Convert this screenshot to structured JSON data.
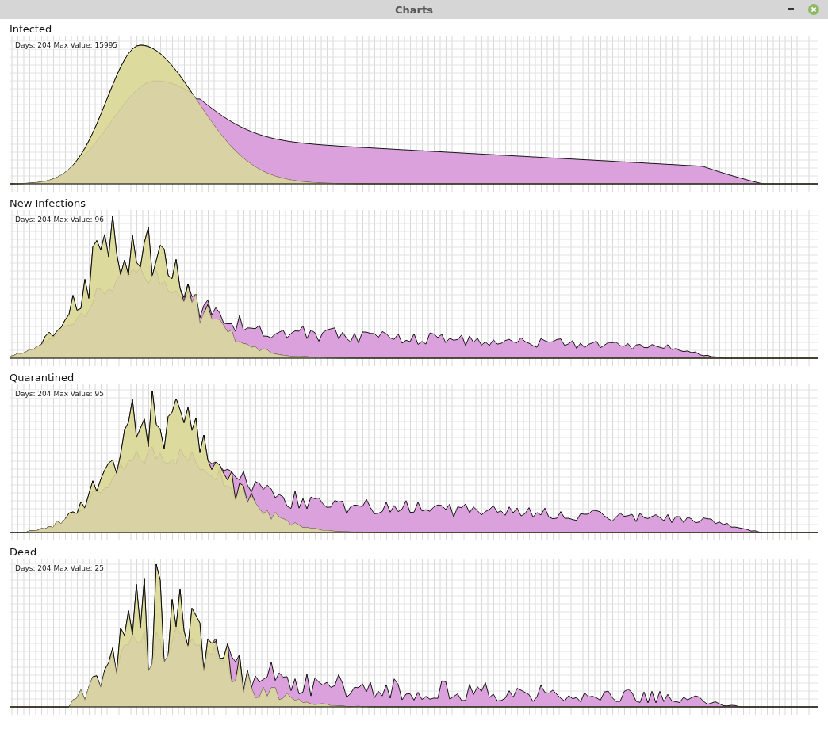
{
  "window": {
    "title": "Charts"
  },
  "charts": [
    {
      "title": "Infected",
      "info": "Days: 204 Max Value: 15995",
      "kind": "smooth"
    },
    {
      "title": "New Infections",
      "info": "Days: 204 Max Value: 96",
      "kind": "noisy"
    },
    {
      "title": "Quarantined",
      "info": "Days: 204 Max Value: 95",
      "kind": "noisy"
    },
    {
      "title": "Dead",
      "info": "Days: 204 Max Value: 25",
      "kind": "spiky"
    }
  ]
}
